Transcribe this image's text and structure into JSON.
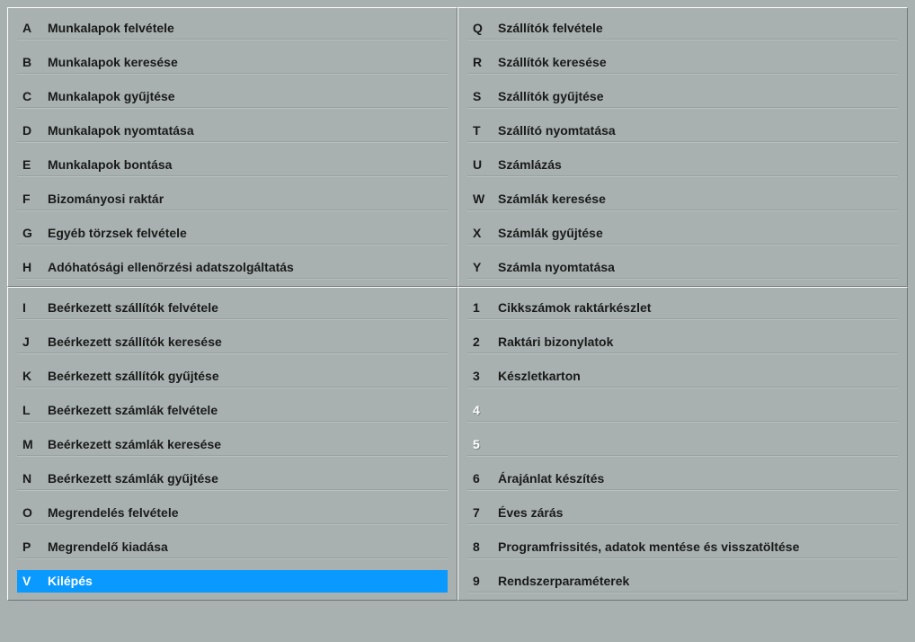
{
  "panels": [
    {
      "id": "top-left",
      "items": [
        {
          "key": "A",
          "label": "Munkalapok felvétele",
          "selected": false,
          "disabled": false
        },
        {
          "key": "B",
          "label": "Munkalapok keresése",
          "selected": false,
          "disabled": false
        },
        {
          "key": "C",
          "label": "Munkalapok gyűjtése",
          "selected": false,
          "disabled": false
        },
        {
          "key": "D",
          "label": "Munkalapok nyomtatása",
          "selected": false,
          "disabled": false
        },
        {
          "key": "E",
          "label": "Munkalapok bontása",
          "selected": false,
          "disabled": false
        },
        {
          "key": "F",
          "label": "Bizományosi raktár",
          "selected": false,
          "disabled": false
        },
        {
          "key": "G",
          "label": "Egyéb törzsek felvétele",
          "selected": false,
          "disabled": false
        },
        {
          "key": "H",
          "label": "Adóhatósági ellenőrzési adatszolgáltatás",
          "selected": false,
          "disabled": false
        }
      ]
    },
    {
      "id": "top-right",
      "items": [
        {
          "key": "Q",
          "label": "Szállítók felvétele",
          "selected": false,
          "disabled": false
        },
        {
          "key": "R",
          "label": "Szállítók keresése",
          "selected": false,
          "disabled": false
        },
        {
          "key": "S",
          "label": "Szállítók gyűjtése",
          "selected": false,
          "disabled": false
        },
        {
          "key": "T",
          "label": "Szállító nyomtatása",
          "selected": false,
          "disabled": false
        },
        {
          "key": "U",
          "label": "Számlázás",
          "selected": false,
          "disabled": false
        },
        {
          "key": "W",
          "label": "Számlák keresése",
          "selected": false,
          "disabled": false
        },
        {
          "key": "X",
          "label": "Számlák gyűjtése",
          "selected": false,
          "disabled": false
        },
        {
          "key": "Y",
          "label": "Számla nyomtatása",
          "selected": false,
          "disabled": false
        }
      ]
    },
    {
      "id": "bottom-left",
      "items": [
        {
          "key": "I",
          "label": "Beérkezett szállítók felvétele",
          "selected": false,
          "disabled": false
        },
        {
          "key": "J",
          "label": "Beérkezett szállítók keresése",
          "selected": false,
          "disabled": false
        },
        {
          "key": "K",
          "label": "Beérkezett szállítók gyűjtése",
          "selected": false,
          "disabled": false
        },
        {
          "key": "L",
          "label": "Beérkezett számlák felvétele",
          "selected": false,
          "disabled": false
        },
        {
          "key": "M",
          "label": "Beérkezett számlák keresése",
          "selected": false,
          "disabled": false
        },
        {
          "key": "N",
          "label": "Beérkezett számlák gyűjtése",
          "selected": false,
          "disabled": false
        },
        {
          "key": "O",
          "label": "Megrendelés felvétele",
          "selected": false,
          "disabled": false
        },
        {
          "key": "P",
          "label": "Megrendelő kiadása",
          "selected": false,
          "disabled": false
        },
        {
          "key": "V",
          "label": "Kilépés",
          "selected": true,
          "disabled": false
        }
      ]
    },
    {
      "id": "bottom-right",
      "items": [
        {
          "key": "1",
          "label": "Cikkszámok raktárkészlet",
          "selected": false,
          "disabled": false
        },
        {
          "key": "2",
          "label": "Raktári bizonylatok",
          "selected": false,
          "disabled": false
        },
        {
          "key": "3",
          "label": "Készletkarton",
          "selected": false,
          "disabled": false
        },
        {
          "key": "4",
          "label": "",
          "selected": false,
          "disabled": true
        },
        {
          "key": "5",
          "label": "",
          "selected": false,
          "disabled": true
        },
        {
          "key": "6",
          "label": "Árajánlat készítés",
          "selected": false,
          "disabled": false
        },
        {
          "key": "7",
          "label": "Éves zárás",
          "selected": false,
          "disabled": false
        },
        {
          "key": "8",
          "label": "Programfrissités, adatok mentése és visszatöltése",
          "selected": false,
          "disabled": false
        },
        {
          "key": "9",
          "label": "Rendszerparaméterek",
          "selected": false,
          "disabled": false
        }
      ]
    }
  ]
}
